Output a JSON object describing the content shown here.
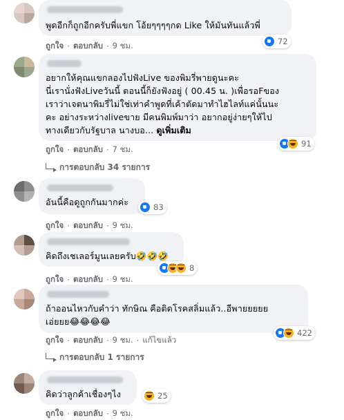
{
  "labels": {
    "like": "ถูกใจ",
    "reply": "ตอบกลับ",
    "separator": "·",
    "see_more": "ดูเพิ่มเติม"
  },
  "comments": [
    {
      "text": "พูดอีกก็ถูกอีกครับพี่แขก โอ้ยๆๆๆๆกด Like ให้มันทันแล้วพี่",
      "time": "9 ชม.",
      "reactions": [
        "like-icon"
      ],
      "count": "72"
    },
    {
      "text": "อยากให้คุณแขกลองไปฟังLive ของพิมรี่พายดูนะคะ\nนี่เรานั่งฟังLiveวันนี้ ตอนนี้ก็ยังฟังอยู่ ( 00.45 น. )เพื่อรอFของ\nเราว่าเจตนาพิมรี่ไม่ใช่เท่าคำพูดที่เค้าตัดมาทำไฮไลท์แค่นั้นนะ\nคะ อย่างระหว่างliveขาย มีคนพิมพ์มาว่า อยากอยู่ง่ายๆให้ไป\nทางเดียวกับรัฐบาล นางบอ...",
      "time": "7 ชม.",
      "reactions": [
        "like-icon",
        "haha-icon"
      ],
      "count": "91",
      "replies": "การตอบกลับ 34 รายการ"
    },
    {
      "text": "อันนี้คือดูถูกกันมากค่ะ",
      "time": "9 ชม.",
      "reactions": [
        "like-icon"
      ],
      "count": "83"
    },
    {
      "text": "คิดถึงเชเลอร์มูนเลยครับ🤣🤣🤣",
      "time": "9 ชม.",
      "reactions": [
        "like-icon",
        "haha-icon",
        "haha-icon"
      ],
      "count": "8"
    },
    {
      "text": "ถ้าออนไหวกับคำว่า ทักษิณ คือติดโรคสลิ่มแล้ว..อีพายยยยย\nเอ่ยยย😂😂😂😂",
      "time": "9 ชม.",
      "edited": "แก้ไขแล้ว",
      "reactions": [
        "like-icon",
        "haha-icon"
      ],
      "count": "422",
      "replies": "การตอบกลับ 1 รายการ"
    },
    {
      "text": "คิดว่าลูกค้าเชื่องๆไง",
      "time": "9 ชม.",
      "reactions": [
        "haha-icon"
      ],
      "count": "25"
    }
  ]
}
